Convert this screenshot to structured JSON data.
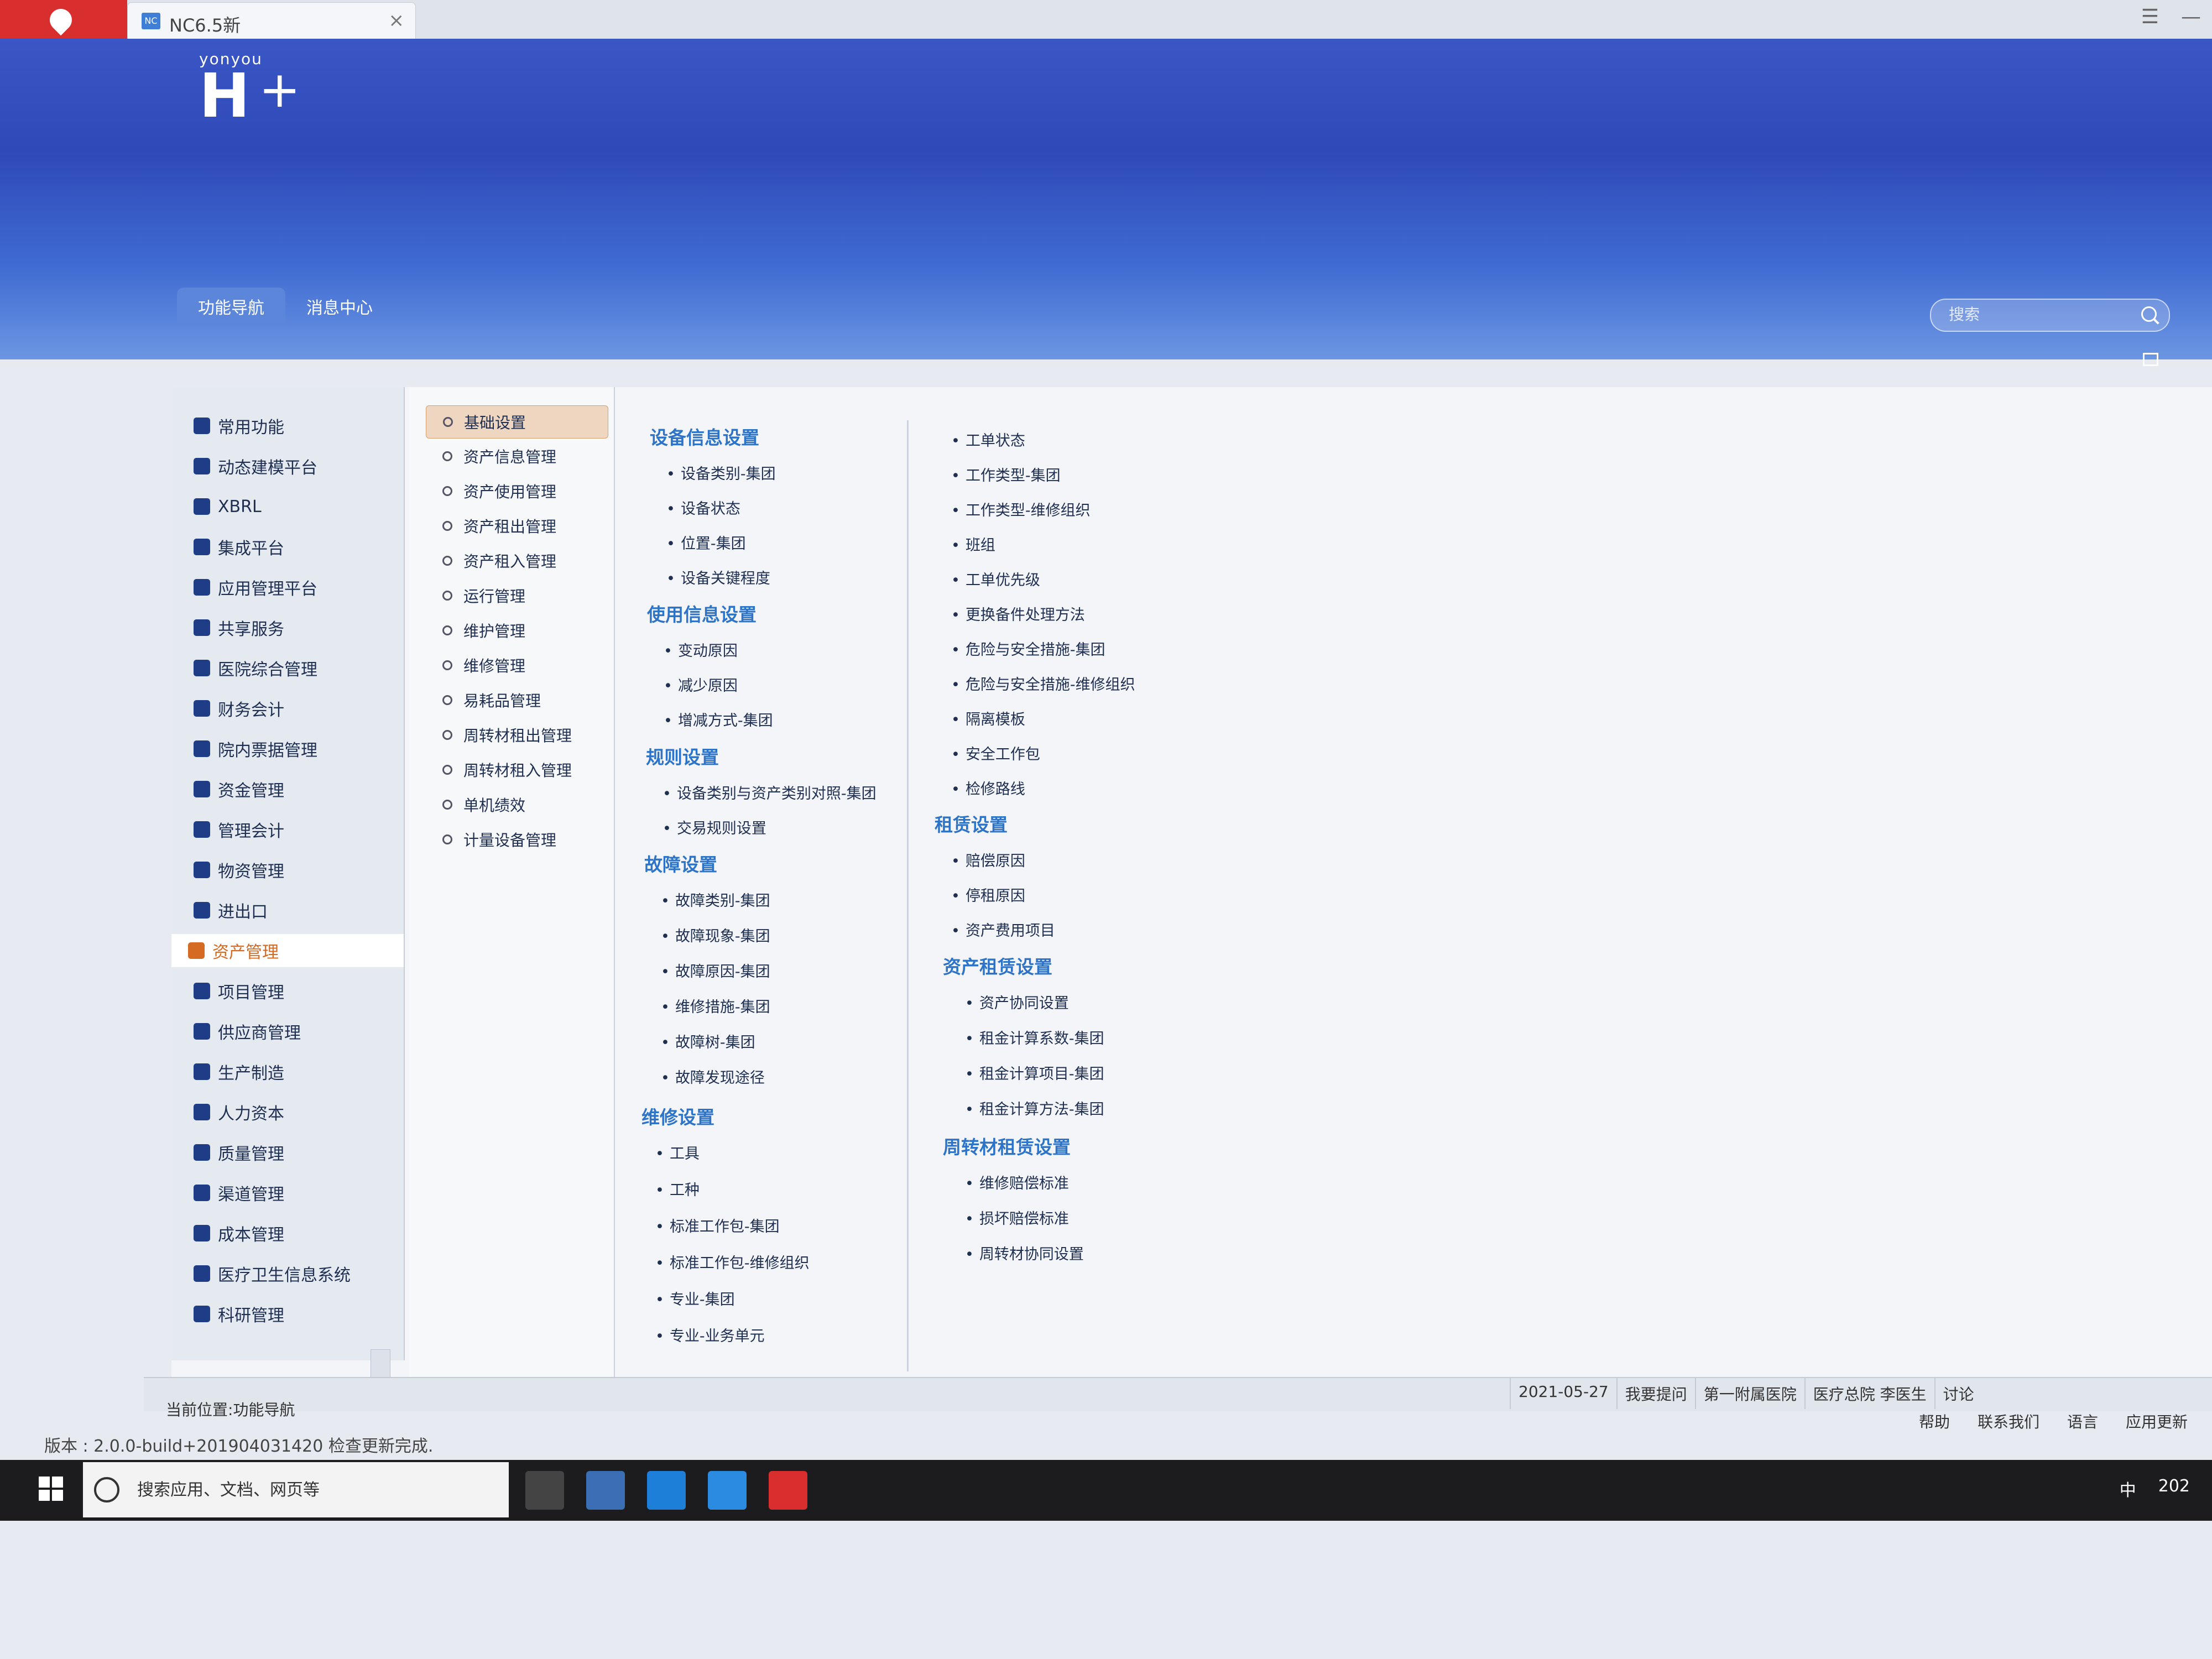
{
  "titlebar": {
    "tab_title": "NC6.5新",
    "tab_icon": "NC",
    "close": "×",
    "menu": "☰",
    "minimize": "—"
  },
  "header": {
    "logo_small": "yonyou",
    "logo_big": "H",
    "logo_plus": "+",
    "tabs": [
      {
        "label": "功能导航"
      },
      {
        "label": "消息中心"
      }
    ],
    "search_placeholder": "搜索"
  },
  "left_nav": {
    "items": [
      {
        "label": "常用功能"
      },
      {
        "label": "动态建模平台"
      },
      {
        "label": "XBRL"
      },
      {
        "label": "集成平台"
      },
      {
        "label": "应用管理平台"
      },
      {
        "label": "共享服务"
      },
      {
        "label": "医院综合管理"
      },
      {
        "label": "财务会计"
      },
      {
        "label": "院内票据管理"
      },
      {
        "label": "资金管理"
      },
      {
        "label": "管理会计"
      },
      {
        "label": "物资管理"
      },
      {
        "label": "进出口"
      },
      {
        "label": "资产管理"
      },
      {
        "label": "项目管理"
      },
      {
        "label": "供应商管理"
      },
      {
        "label": "生产制造"
      },
      {
        "label": "人力资本"
      },
      {
        "label": "质量管理"
      },
      {
        "label": "渠道管理"
      },
      {
        "label": "成本管理"
      },
      {
        "label": "医疗卫生信息系统"
      },
      {
        "label": "科研管理"
      }
    ]
  },
  "sub_nav": {
    "items": [
      {
        "label": "基础设置"
      },
      {
        "label": "资产信息管理"
      },
      {
        "label": "资产使用管理"
      },
      {
        "label": "资产租出管理"
      },
      {
        "label": "资产租入管理"
      },
      {
        "label": "运行管理"
      },
      {
        "label": "维护管理"
      },
      {
        "label": "维修管理"
      },
      {
        "label": "易耗品管理"
      },
      {
        "label": "周转材租出管理"
      },
      {
        "label": "周转材租入管理"
      },
      {
        "label": "单机绩效"
      },
      {
        "label": "计量设备管理"
      }
    ]
  },
  "col1": {
    "s1": {
      "title": "设备信息设置",
      "links": [
        "设备类别-集团",
        "设备状态",
        "位置-集团",
        "设备关键程度"
      ]
    },
    "s2": {
      "title": "使用信息设置",
      "links": [
        "变动原因",
        "减少原因",
        "增减方式-集团"
      ]
    },
    "s3": {
      "title": "规则设置",
      "links": [
        "设备类别与资产类别对照-集团",
        "交易规则设置"
      ]
    },
    "s4": {
      "title": "故障设置",
      "links": [
        "故障类别-集团",
        "故障现象-集团",
        "故障原因-集团",
        "维修措施-集团",
        "故障树-集团",
        "故障发现途径"
      ]
    },
    "s5": {
      "title": "维修设置",
      "links": [
        "工具",
        "工种",
        "标准工作包-集团",
        "标准工作包-维修组织",
        "专业-集团",
        "专业-业务单元"
      ]
    }
  },
  "col2": {
    "top_links": [
      "工单状态",
      "工作类型-集团",
      "工作类型-维修组织",
      "班组",
      "工单优先级",
      "更换备件处理方法",
      "危险与安全措施-集团",
      "危险与安全措施-维修组织",
      "隔离模板",
      "安全工作包",
      "检修路线"
    ],
    "s6": {
      "title": "租赁设置",
      "links": [
        "赔偿原因",
        "停租原因",
        "资产费用项目"
      ]
    },
    "s7": {
      "title": "资产租赁设置",
      "links": [
        "资产协同设置",
        "租金计算系数-集团",
        "租金计算项目-集团",
        "租金计算方法-集团"
      ]
    },
    "s8": {
      "title": "周转材租赁设置",
      "links": [
        "维修赔偿标准",
        "损坏赔偿标准",
        "周转材协同设置"
      ]
    }
  },
  "status": {
    "location": "当前位置:功能导航",
    "date": "2021-05-27",
    "ask": "我要提问",
    "org": "第一附属医院",
    "dept_user": "医疗总院 李医生",
    "discuss": "讨论",
    "help": "帮助",
    "contact": "联系我们",
    "language": "语言",
    "app_update": "应用更新"
  },
  "version": "版本 : 2.0.0-build+201904031420  检查更新完成.",
  "taskbar": {
    "search_placeholder": "搜索应用、文档、网页等",
    "lang": "中",
    "year": "202"
  },
  "colors": {
    "accent": "#2d74c9",
    "active_orange": "#d56a23",
    "header_blue": "#2f49b8"
  }
}
